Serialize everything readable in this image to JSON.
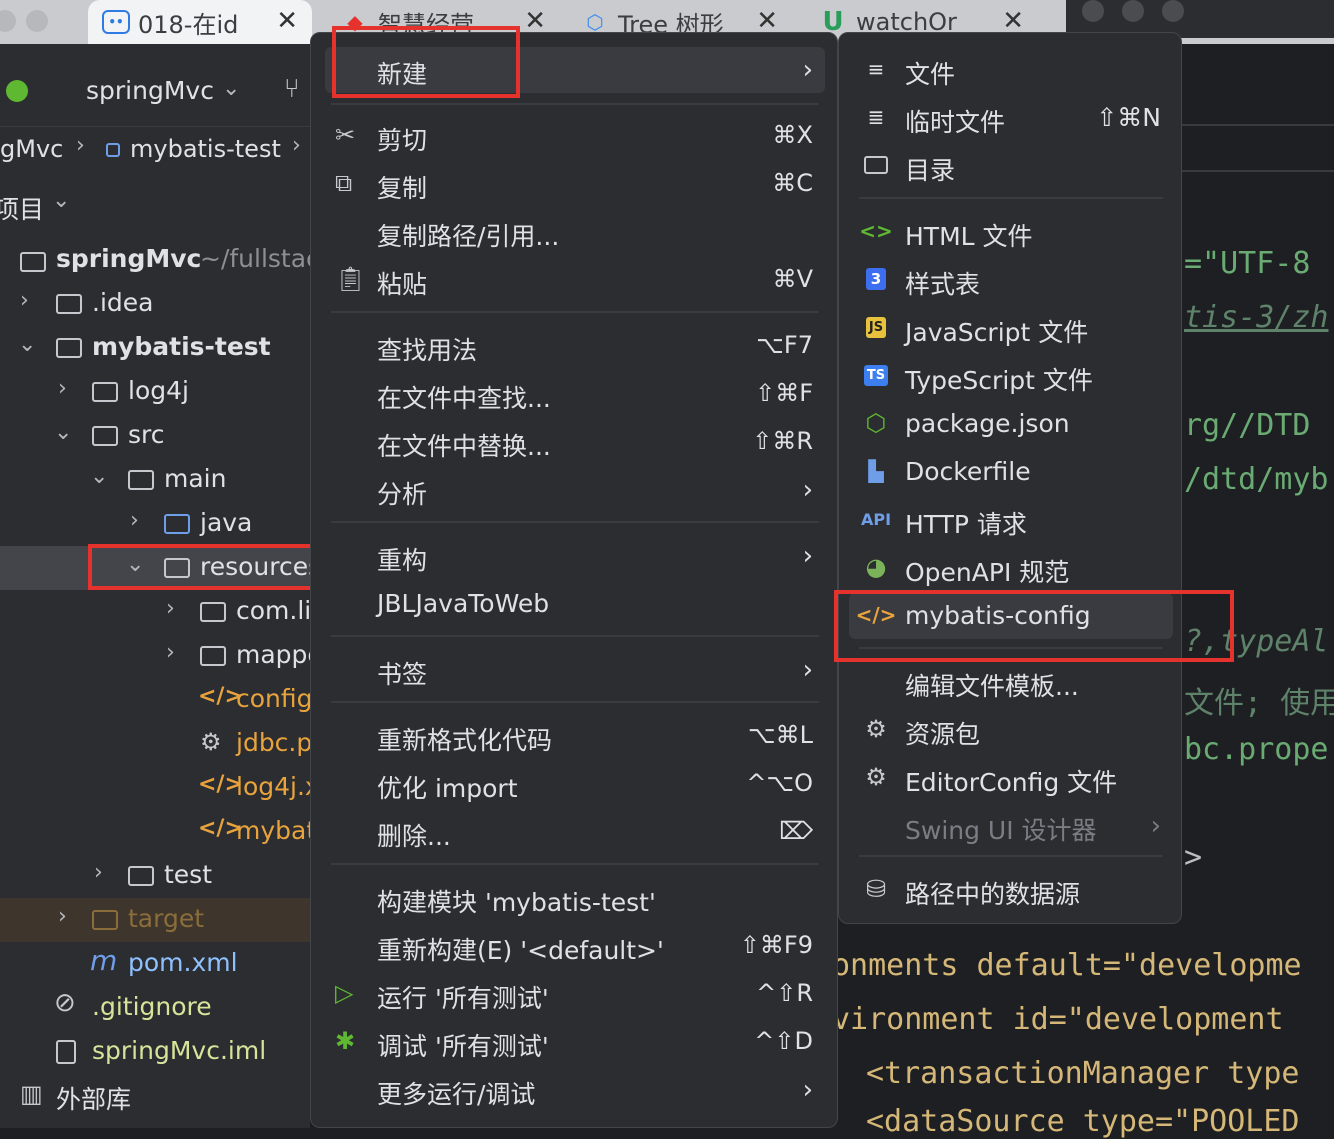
{
  "browser": {
    "tabs": [
      {
        "label": "018-在id",
        "active": true
      },
      {
        "label": "智慧经营"
      },
      {
        "label": "Tree 树形"
      },
      {
        "label": "watchOr"
      }
    ],
    "close_glyph": "✕"
  },
  "ide": {
    "project_name": "springMvc",
    "breadcrumb": [
      "gMvc",
      "mybatis-test"
    ],
    "project_view_label": "项目",
    "tree": [
      {
        "label": "springMvc",
        "suffix": "~/fullstac"
      },
      {
        "label": ".idea"
      },
      {
        "label": "mybatis-test"
      },
      {
        "label": "log4j"
      },
      {
        "label": "src"
      },
      {
        "label": "main"
      },
      {
        "label": "java"
      },
      {
        "label": "resources"
      },
      {
        "label": "com.li"
      },
      {
        "label": "mapper"
      },
      {
        "label": "config"
      },
      {
        "label": "jdbc.p"
      },
      {
        "label": "log4j.x"
      },
      {
        "label": "mybat"
      },
      {
        "label": "test"
      },
      {
        "label": "target"
      },
      {
        "label": "pom.xml"
      },
      {
        "label": ".gitignore"
      },
      {
        "label": "springMvc.iml"
      },
      {
        "label": "外部库"
      }
    ]
  },
  "context_menu": {
    "items": [
      {
        "label": "新建"
      },
      {
        "label": "剪切",
        "shortcut": "⌘X"
      },
      {
        "label": "复制",
        "shortcut": "⌘C"
      },
      {
        "label": "复制路径/引用..."
      },
      {
        "label": "粘贴",
        "shortcut": "⌘V"
      },
      {
        "label": "查找用法",
        "shortcut": "⌥F7"
      },
      {
        "label": "在文件中查找...",
        "shortcut": "⇧⌘F"
      },
      {
        "label": "在文件中替换...",
        "shortcut": "⇧⌘R"
      },
      {
        "label": "分析"
      },
      {
        "label": "重构"
      },
      {
        "label": "JBLJavaToWeb"
      },
      {
        "label": "书签"
      },
      {
        "label": "重新格式化代码",
        "shortcut": "⌥⌘L"
      },
      {
        "label": "优化 import",
        "shortcut": "^⌥O"
      },
      {
        "label": "删除...",
        "shortcut": "⌦"
      },
      {
        "label": "构建模块 'mybatis-test'"
      },
      {
        "label": "重新构建(E) '<default>'",
        "shortcut": "⇧⌘F9"
      },
      {
        "label": "运行 '所有测试'",
        "shortcut": "^⇧R"
      },
      {
        "label": "调试 '所有测试'",
        "shortcut": "^⇧D"
      },
      {
        "label": "更多运行/调试"
      }
    ]
  },
  "new_submenu": {
    "items": [
      {
        "label": "文件"
      },
      {
        "label": "临时文件",
        "shortcut": "⇧⌘N"
      },
      {
        "label": "目录"
      },
      {
        "label": "HTML 文件"
      },
      {
        "label": "样式表"
      },
      {
        "label": "JavaScript 文件"
      },
      {
        "label": "TypeScript 文件"
      },
      {
        "label": "package.json"
      },
      {
        "label": "Dockerfile"
      },
      {
        "label": "HTTP 请求"
      },
      {
        "label": "OpenAPI 规范"
      },
      {
        "label": "mybatis-config"
      },
      {
        "label": "编辑文件模板..."
      },
      {
        "label": "资源包"
      },
      {
        "label": "EditorConfig 文件"
      },
      {
        "label": "Swing UI 设计器"
      },
      {
        "label": "路径中的数据源"
      }
    ]
  },
  "editor": {
    "lines": [
      "=\"UTF-8",
      "tis-3/zh",
      "rg//DTD",
      "/dtd/myb",
      "?,typeAl",
      "文件; 使用",
      "bc.prope",
      ">",
      "onments default=\"developme",
      "vironment id=\"development",
      "<transactionManager type",
      "<dataSource type=\"POOLED"
    ]
  },
  "colors": {
    "highlight": "#e5322d",
    "accent_blue": "#6f9de8",
    "xml": "#e8a33d"
  }
}
